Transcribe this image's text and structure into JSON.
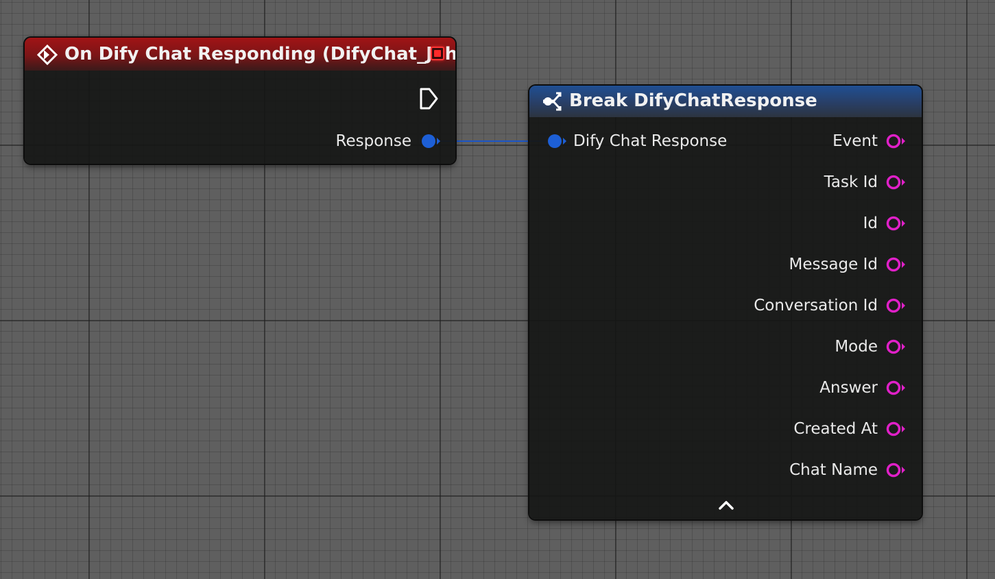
{
  "event_node": {
    "title": "On Dify Chat Responding (DifyChat_John)",
    "icon": "event-diamond-icon",
    "header_color": "#a11416",
    "output_pins": [
      {
        "label": "Response",
        "type": "struct",
        "color": "#1d5fd6"
      }
    ],
    "exec_pin_icon": "exec-output-icon"
  },
  "break_node": {
    "title": "Break DifyChatResponse",
    "icon": "break-struct-icon",
    "header_color": "#1f4f93",
    "input_pins": [
      {
        "label": "Dify Chat Response",
        "type": "struct",
        "color": "#1d5fd6"
      }
    ],
    "output_pins": [
      {
        "label": "Event",
        "type": "string",
        "color": "#e020c8"
      },
      {
        "label": "Task Id",
        "type": "string",
        "color": "#e020c8"
      },
      {
        "label": "Id",
        "type": "string",
        "color": "#e020c8"
      },
      {
        "label": "Message Id",
        "type": "string",
        "color": "#e020c8"
      },
      {
        "label": "Conversation Id",
        "type": "string",
        "color": "#e020c8"
      },
      {
        "label": "Mode",
        "type": "string",
        "color": "#e020c8"
      },
      {
        "label": "Answer",
        "type": "string",
        "color": "#e020c8"
      },
      {
        "label": "Created At",
        "type": "string",
        "color": "#e020c8"
      },
      {
        "label": "Chat Name",
        "type": "string",
        "color": "#e020c8"
      }
    ],
    "collapse_icon": "chevron-up-icon"
  },
  "connection": {
    "from": "Response",
    "to": "Dify Chat Response",
    "color": "#1b55c8"
  }
}
